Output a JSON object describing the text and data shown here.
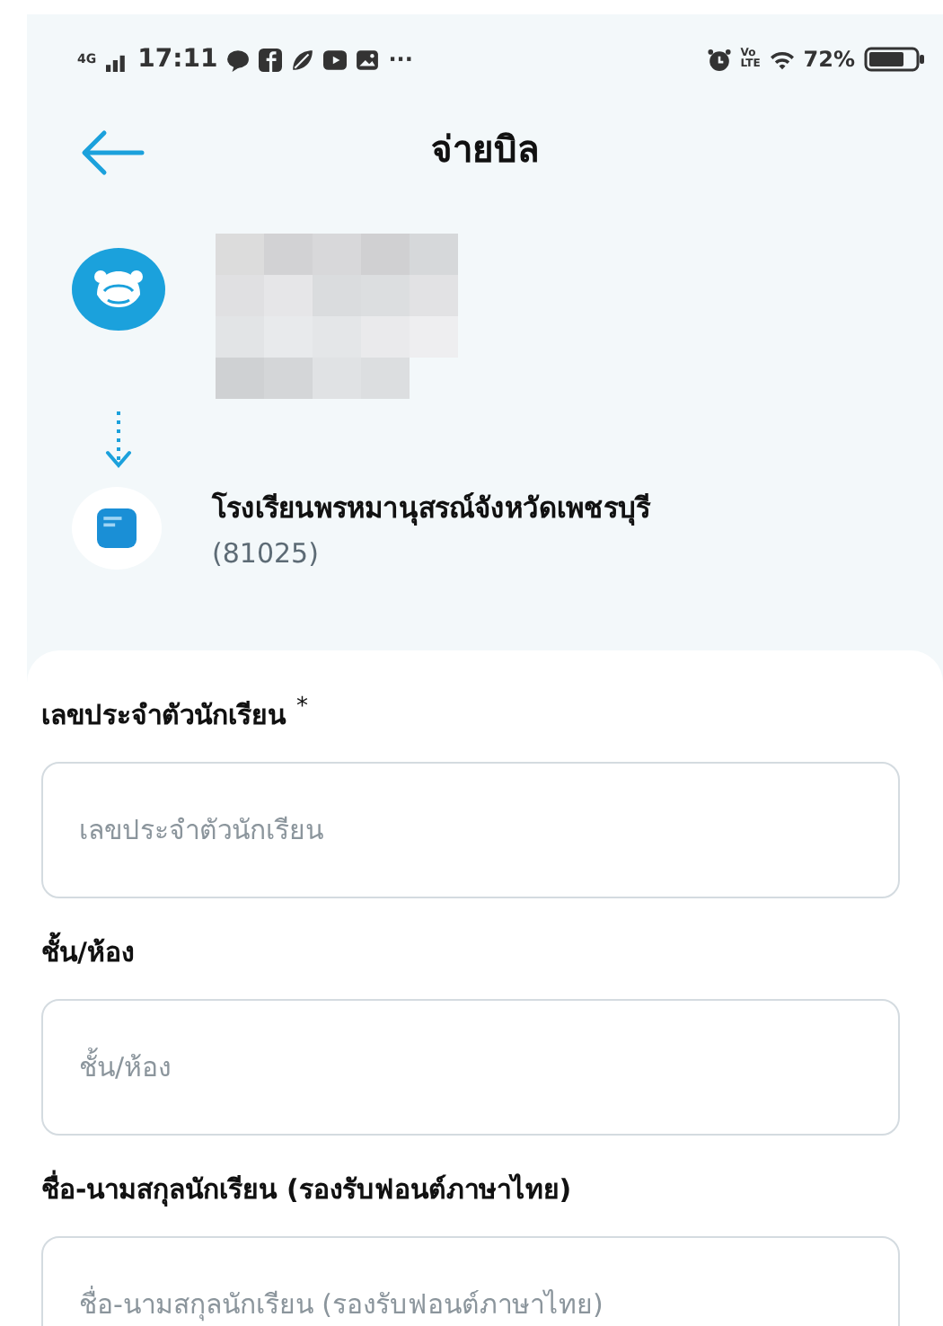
{
  "status_bar": {
    "network": "4G",
    "time": "17:11",
    "more": "···",
    "volte": "Vo LTE",
    "battery": "72%"
  },
  "header": {
    "title": "จ่ายบิล"
  },
  "transfer": {
    "to": {
      "name": "โรงเรียนพรหมานุสรณ์จังหวัดเพชรบุรี",
      "code": "(81025)"
    }
  },
  "form": {
    "fields": [
      {
        "label": "เลขประจำตัวนักเรียน",
        "required_mark": "*",
        "placeholder": "เลขประจำตัวนักเรียน"
      },
      {
        "label": "ชั้น/ห้อง",
        "placeholder": "ชั้น/ห้อง"
      },
      {
        "label": "ชื่อ-นามสกุลนักเรียน (รองรับฟอนต์ภาษาไทย)",
        "placeholder": "ชื่อ-นามสกุลนักเรียน (รองรับฟอนต์ภาษาไทย)"
      }
    ]
  }
}
